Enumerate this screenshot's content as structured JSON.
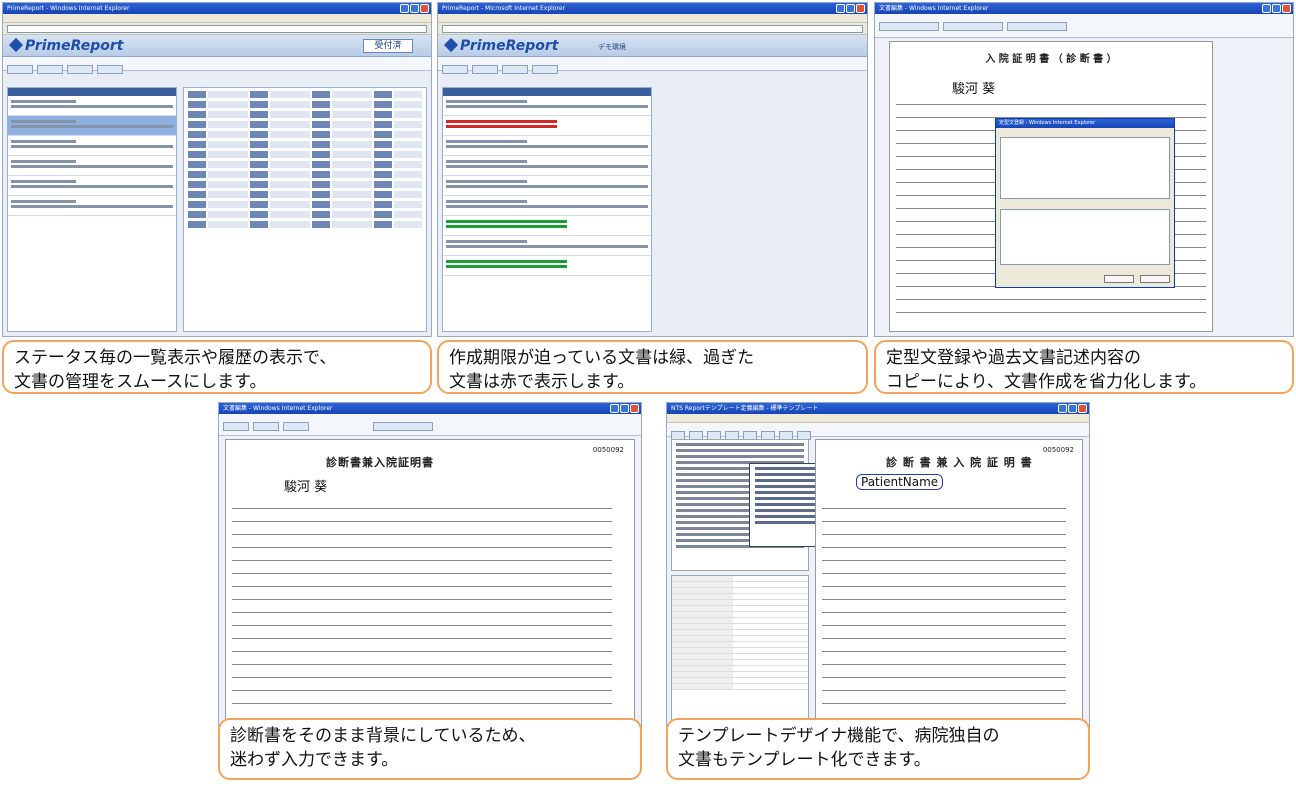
{
  "screens": {
    "s1": {
      "window_title": "PrimeReport - Windows Internet Explorer",
      "logo": "PrimeReport",
      "status_button": "受付済"
    },
    "s2": {
      "window_title": "PrimeReport - Microsoft Internet Explorer",
      "logo": "PrimeReport",
      "mode_label": "デモ環境"
    },
    "s3": {
      "window_title": "文書編集 - Windows Internet Explorer",
      "doc_title": "入 院 証 明 書 （ 診 断 書 ）",
      "patient_name": "駿河 葵",
      "dialog_title": "定型文登録 - Windows Internet Explorer"
    },
    "s4": {
      "window_title": "文書編集 - Windows Internet Explorer",
      "doc_title": "診断書兼入院証明書",
      "patient_name": "駿河 葵",
      "doc_number": "0050092"
    },
    "s5": {
      "window_title": "NTS Reportテンプレート定義編集 - 標準テンプレート",
      "doc_title": "診 断 書 兼 入 院 証 明 書",
      "placeholder": "PatientName",
      "doc_number": "0050092"
    }
  },
  "captions": {
    "c1": "ステータス毎の一覧表示や履歴の表示で、\n文書の管理をスムースにします。",
    "c2": "作成期限が迫っている文書は緑、過ぎた\n文書は赤で表示します。",
    "c3": "定型文登録や過去文書記述内容の\nコピーにより、文書作成を省力化します。",
    "c4": "診断書をそのまま背景にしているため、\n迷わず入力できます。",
    "c5": "テンプレートデザイナ機能で、病院独自の\n文書もテンプレート化できます。"
  },
  "colors": {
    "caption_border": "#f0a35a",
    "title_bar": "#1745b4",
    "near_deadline": "#1f9a3a",
    "overdue": "#d22a2a"
  }
}
